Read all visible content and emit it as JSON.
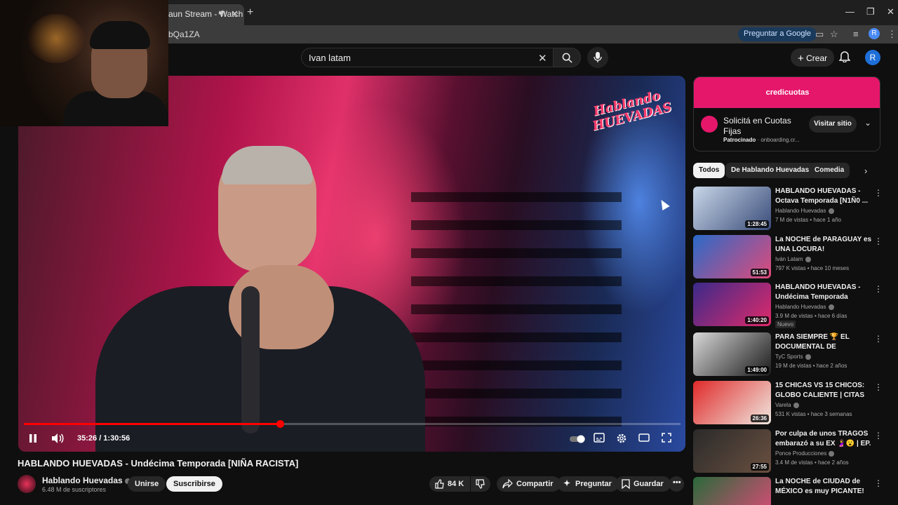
{
  "browser": {
    "tab_title": "aun Stream - Watch",
    "url_fragment": "bQa1ZA",
    "ask_google": "Preguntar a Google",
    "profile_initial": "R"
  },
  "header": {
    "search_value": "Ivan latam",
    "create_label": "Crear",
    "avatar_initial": "R"
  },
  "player": {
    "time_current": "35:26 / 1:30:56",
    "progress_fraction": 0.39,
    "overlay_logo": "Hablando HUEVADAS"
  },
  "video": {
    "title": "HABLANDO HUEVADAS - Undécima Temporada [NIÑA RACISTA]",
    "channel": "Hablando Huevadas",
    "subscribers": "6.48 M de suscriptores",
    "join_label": "Unirse",
    "subscribe_label": "Suscribirse",
    "likes": "84 K",
    "share_label": "Compartir",
    "ask_label": "Preguntar",
    "save_label": "Guardar"
  },
  "ad": {
    "banner_text": "credicuotas",
    "title": "Solicitá en Cuotas Fijas",
    "sponsored": "Patrocinado",
    "domain": "· onboarding.cr...",
    "visit_label": "Visitar sitio"
  },
  "chips": [
    "Todos",
    "De Hablando Huevadas",
    "Comedia"
  ],
  "related": [
    {
      "title": "HABLANDO HUEVADAS - Octava Temporada [N1Ñ0 ...",
      "channel": "Hablando Huevadas",
      "meta": "7 M de vistas • hace 1 año",
      "duration": "1:28:45",
      "badge": "",
      "color1": "#c9d7e8",
      "color2": "#3a4c7a"
    },
    {
      "title": "La NOCHE de PARAGUAY es UNA LOCURA!",
      "channel": "Iván Latam",
      "meta": "797 K vistas • hace 10 meses",
      "duration": "51:53",
      "badge": "",
      "color1": "#2a6ac8",
      "color2": "#e04a7a"
    },
    {
      "title": "HABLANDO HUEVADAS - Undécima Temporada [JORGE ...",
      "channel": "Hablando Huevadas",
      "meta": "3.9 M de vistas • hace 6 días",
      "duration": "1:40:20",
      "badge": "Nuevo",
      "color1": "#3a2a8a",
      "color2": "#e02a6a"
    },
    {
      "title": "PARA SIEMPRE 🏆 EL DOCUMENTAL DE ARGENTIN...",
      "channel": "TyC Sports",
      "meta": "19 M de vistas • hace 2 años",
      "duration": "1:49:00",
      "badge": "",
      "color1": "#d8d8d8",
      "color2": "#1a1a1a"
    },
    {
      "title": "15 CHICAS VS 15 CHICOS: GLOBO CALIENTE | CITAS DE ...",
      "channel": "Varela",
      "meta": "531 K vistas • hace 3 semanas",
      "duration": "26:36",
      "badge": "",
      "color1": "#e02a2a",
      "color2": "#f0e8e0"
    },
    {
      "title": "Por culpa de unos TRAGOS embarazó a su EX 🤰😮 | EP. 0...",
      "channel": "Ponce Producciones",
      "meta": "3.4 M de vistas • hace 2 años",
      "duration": "27:55",
      "badge": "",
      "color1": "#2a2a2a",
      "color2": "#6a5040"
    },
    {
      "title": "La NOCHE de CIUDAD de MÉXICO es muy PICANTE!",
      "channel": "",
      "meta": "",
      "duration": "",
      "badge": "",
      "color1": "#2a6a3a",
      "color2": "#e04a7a"
    }
  ]
}
